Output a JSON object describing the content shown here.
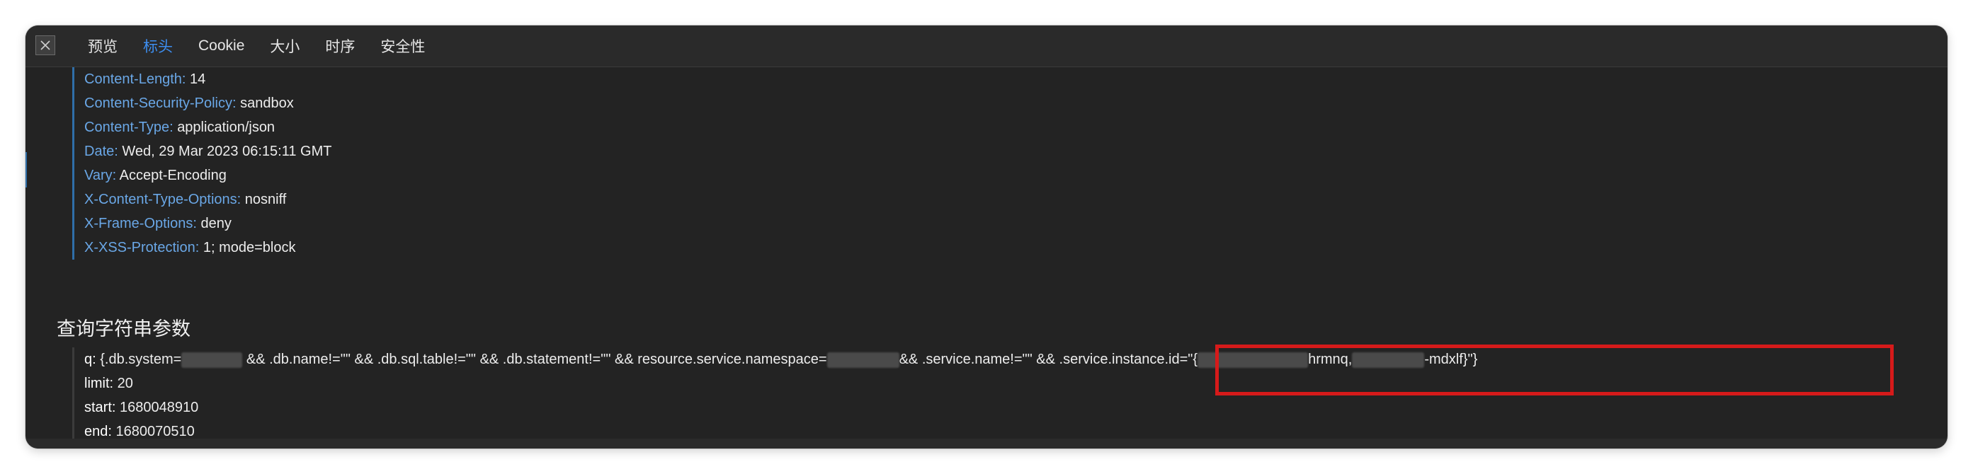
{
  "toolbar": {
    "close_icon": "close-icon",
    "tabs": [
      {
        "label": "预览",
        "active": false
      },
      {
        "label": "标头",
        "active": true
      },
      {
        "label": "Cookie",
        "active": false
      },
      {
        "label": "大小",
        "active": false
      },
      {
        "label": "时序",
        "active": false
      },
      {
        "label": "安全性",
        "active": false
      }
    ]
  },
  "headers": [
    {
      "key": "Content-Length:",
      "value": "14"
    },
    {
      "key": "Content-Security-Policy:",
      "value": "sandbox"
    },
    {
      "key": "Content-Type:",
      "value": "application/json"
    },
    {
      "key": "Date:",
      "value": "Wed, 29 Mar 2023 06:15:11 GMT"
    },
    {
      "key": "Vary:",
      "value": "Accept-Encoding"
    },
    {
      "key": "X-Content-Type-Options:",
      "value": "nosniff"
    },
    {
      "key": "X-Frame-Options:",
      "value": "deny"
    },
    {
      "key": "X-XSS-Protection:",
      "value": "1; mode=block"
    }
  ],
  "query_section": {
    "title": "查询字符串参数",
    "q": {
      "key": "q:",
      "part1": "{.db.system=",
      "part2": " && .db.name!=\"\" && .db.sql.table!=\"\" && .db.statement!=\"\" && resource.service.namespace=",
      "part3": "&& .service.name!=\"\" && ",
      "part4": ".service.instance.id=\"{",
      "part5": "hrmnq,",
      "part6": "-mdxlf}\"}"
    },
    "limit": {
      "key": "limit:",
      "value": "20"
    },
    "start": {
      "key": "start:",
      "value": "1680048910"
    },
    "end": {
      "key": "end:",
      "value": "1680070510"
    }
  },
  "colors": {
    "background": "#232323",
    "tab_active": "#3d8ef0",
    "header_key": "#6aa7e6",
    "highlight": "#d61a1a"
  }
}
